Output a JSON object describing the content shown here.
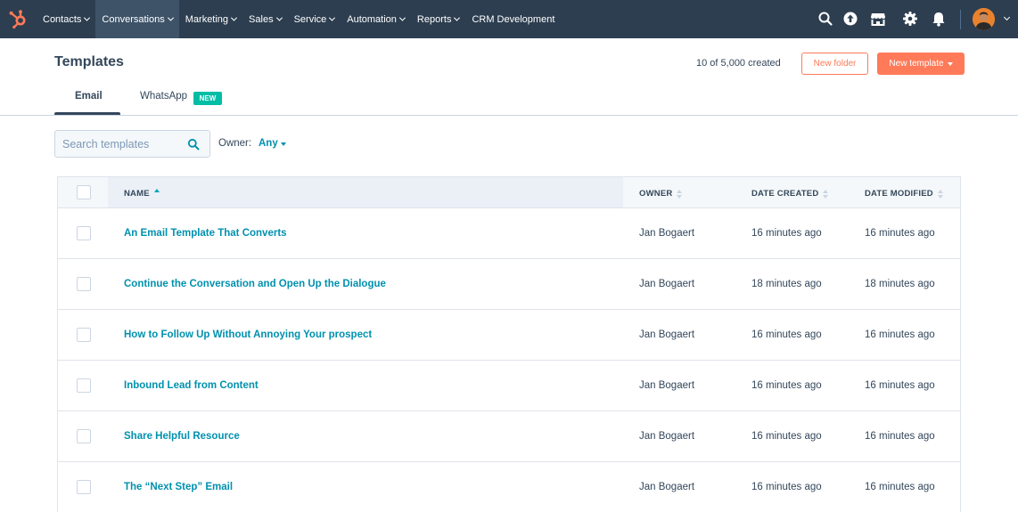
{
  "nav": {
    "items": [
      {
        "label": "Contacts",
        "active": false
      },
      {
        "label": "Conversations",
        "active": true
      },
      {
        "label": "Marketing",
        "active": false
      },
      {
        "label": "Sales",
        "active": false
      },
      {
        "label": "Service",
        "active": false
      },
      {
        "label": "Automation",
        "active": false
      },
      {
        "label": "Reports",
        "active": false
      },
      {
        "label": "CRM Development",
        "active": false,
        "no_chevron": true
      }
    ],
    "icons": [
      "search-icon",
      "upgrade-icon",
      "marketplace-icon",
      "settings-icon",
      "notifications-icon"
    ],
    "brand_color": "#ff7a59"
  },
  "header": {
    "title": "Templates",
    "count": "10 of 5,000 created",
    "new_folder_label": "New folder",
    "new_template_label": "New template"
  },
  "tabs": [
    {
      "label": "Email",
      "active": true
    },
    {
      "label": "WhatsApp",
      "active": false,
      "badge": "NEW"
    }
  ],
  "filters": {
    "search_placeholder": "Search templates",
    "owner_label": "Owner:",
    "owner_value": "Any"
  },
  "table": {
    "columns": {
      "name": "NAME",
      "owner": "OWNER",
      "date_created": "DATE CREATED",
      "date_modified": "DATE MODIFIED"
    },
    "rows": [
      {
        "name": "An Email Template That Converts",
        "owner": "Jan Bogaert",
        "created": "16 minutes ago",
        "modified": "16 minutes ago"
      },
      {
        "name": "Continue the Conversation and Open Up the Dialogue",
        "owner": "Jan Bogaert",
        "created": "18 minutes ago",
        "modified": "18 minutes ago"
      },
      {
        "name": "How to Follow Up Without Annoying Your prospect",
        "owner": "Jan Bogaert",
        "created": "16 minutes ago",
        "modified": "16 minutes ago"
      },
      {
        "name": "Inbound Lead from Content",
        "owner": "Jan Bogaert",
        "created": "16 minutes ago",
        "modified": "16 minutes ago"
      },
      {
        "name": "Share Helpful Resource",
        "owner": "Jan Bogaert",
        "created": "16 minutes ago",
        "modified": "16 minutes ago"
      },
      {
        "name": "The “Next Step” Email",
        "owner": "Jan Bogaert",
        "created": "16 minutes ago",
        "modified": "16 minutes ago"
      }
    ]
  }
}
